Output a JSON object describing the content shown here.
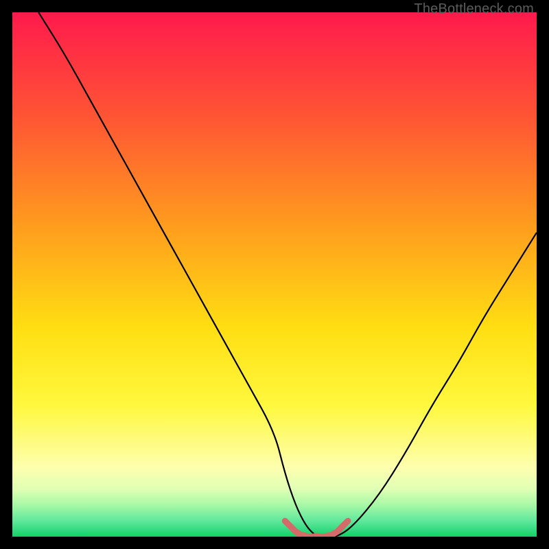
{
  "watermark": "TheBottleneck.com",
  "chart_data": {
    "type": "line",
    "title": "",
    "xlabel": "",
    "ylabel": "",
    "xlim": [
      0,
      100
    ],
    "ylim": [
      0,
      100
    ],
    "grid": false,
    "background_gradient": {
      "stops": [
        {
          "pos": 0.0,
          "color": "#ff1a4c"
        },
        {
          "pos": 0.2,
          "color": "#ff5534"
        },
        {
          "pos": 0.4,
          "color": "#ff9a1e"
        },
        {
          "pos": 0.6,
          "color": "#ffde12"
        },
        {
          "pos": 0.75,
          "color": "#fff83e"
        },
        {
          "pos": 0.87,
          "color": "#fdffb0"
        },
        {
          "pos": 0.91,
          "color": "#dfffb4"
        },
        {
          "pos": 0.94,
          "color": "#a6f8a6"
        },
        {
          "pos": 0.97,
          "color": "#5fe89c"
        },
        {
          "pos": 1.0,
          "color": "#13d06a"
        }
      ]
    },
    "series": [
      {
        "name": "bottleneck-curve",
        "color": "#000000",
        "x": [
          5,
          10,
          15,
          20,
          25,
          30,
          35,
          40,
          45,
          50,
          52,
          54,
          56,
          58,
          60,
          62,
          65,
          70,
          75,
          80,
          85,
          90,
          95,
          100
        ],
        "y": [
          100,
          92,
          83,
          74,
          65,
          56,
          47,
          38,
          29,
          20,
          12,
          6,
          2,
          0,
          0,
          0,
          2,
          8,
          16,
          25,
          33,
          42,
          50,
          58
        ]
      },
      {
        "name": "optimal-zone",
        "color": "#d46a6a",
        "thick": true,
        "x": [
          52,
          53,
          54,
          55,
          56,
          57,
          58,
          59,
          60,
          61,
          62,
          63,
          64
        ],
        "y": [
          3,
          2,
          1,
          0.5,
          0,
          0,
          0,
          0,
          0,
          0.5,
          1,
          2,
          3
        ]
      }
    ]
  }
}
